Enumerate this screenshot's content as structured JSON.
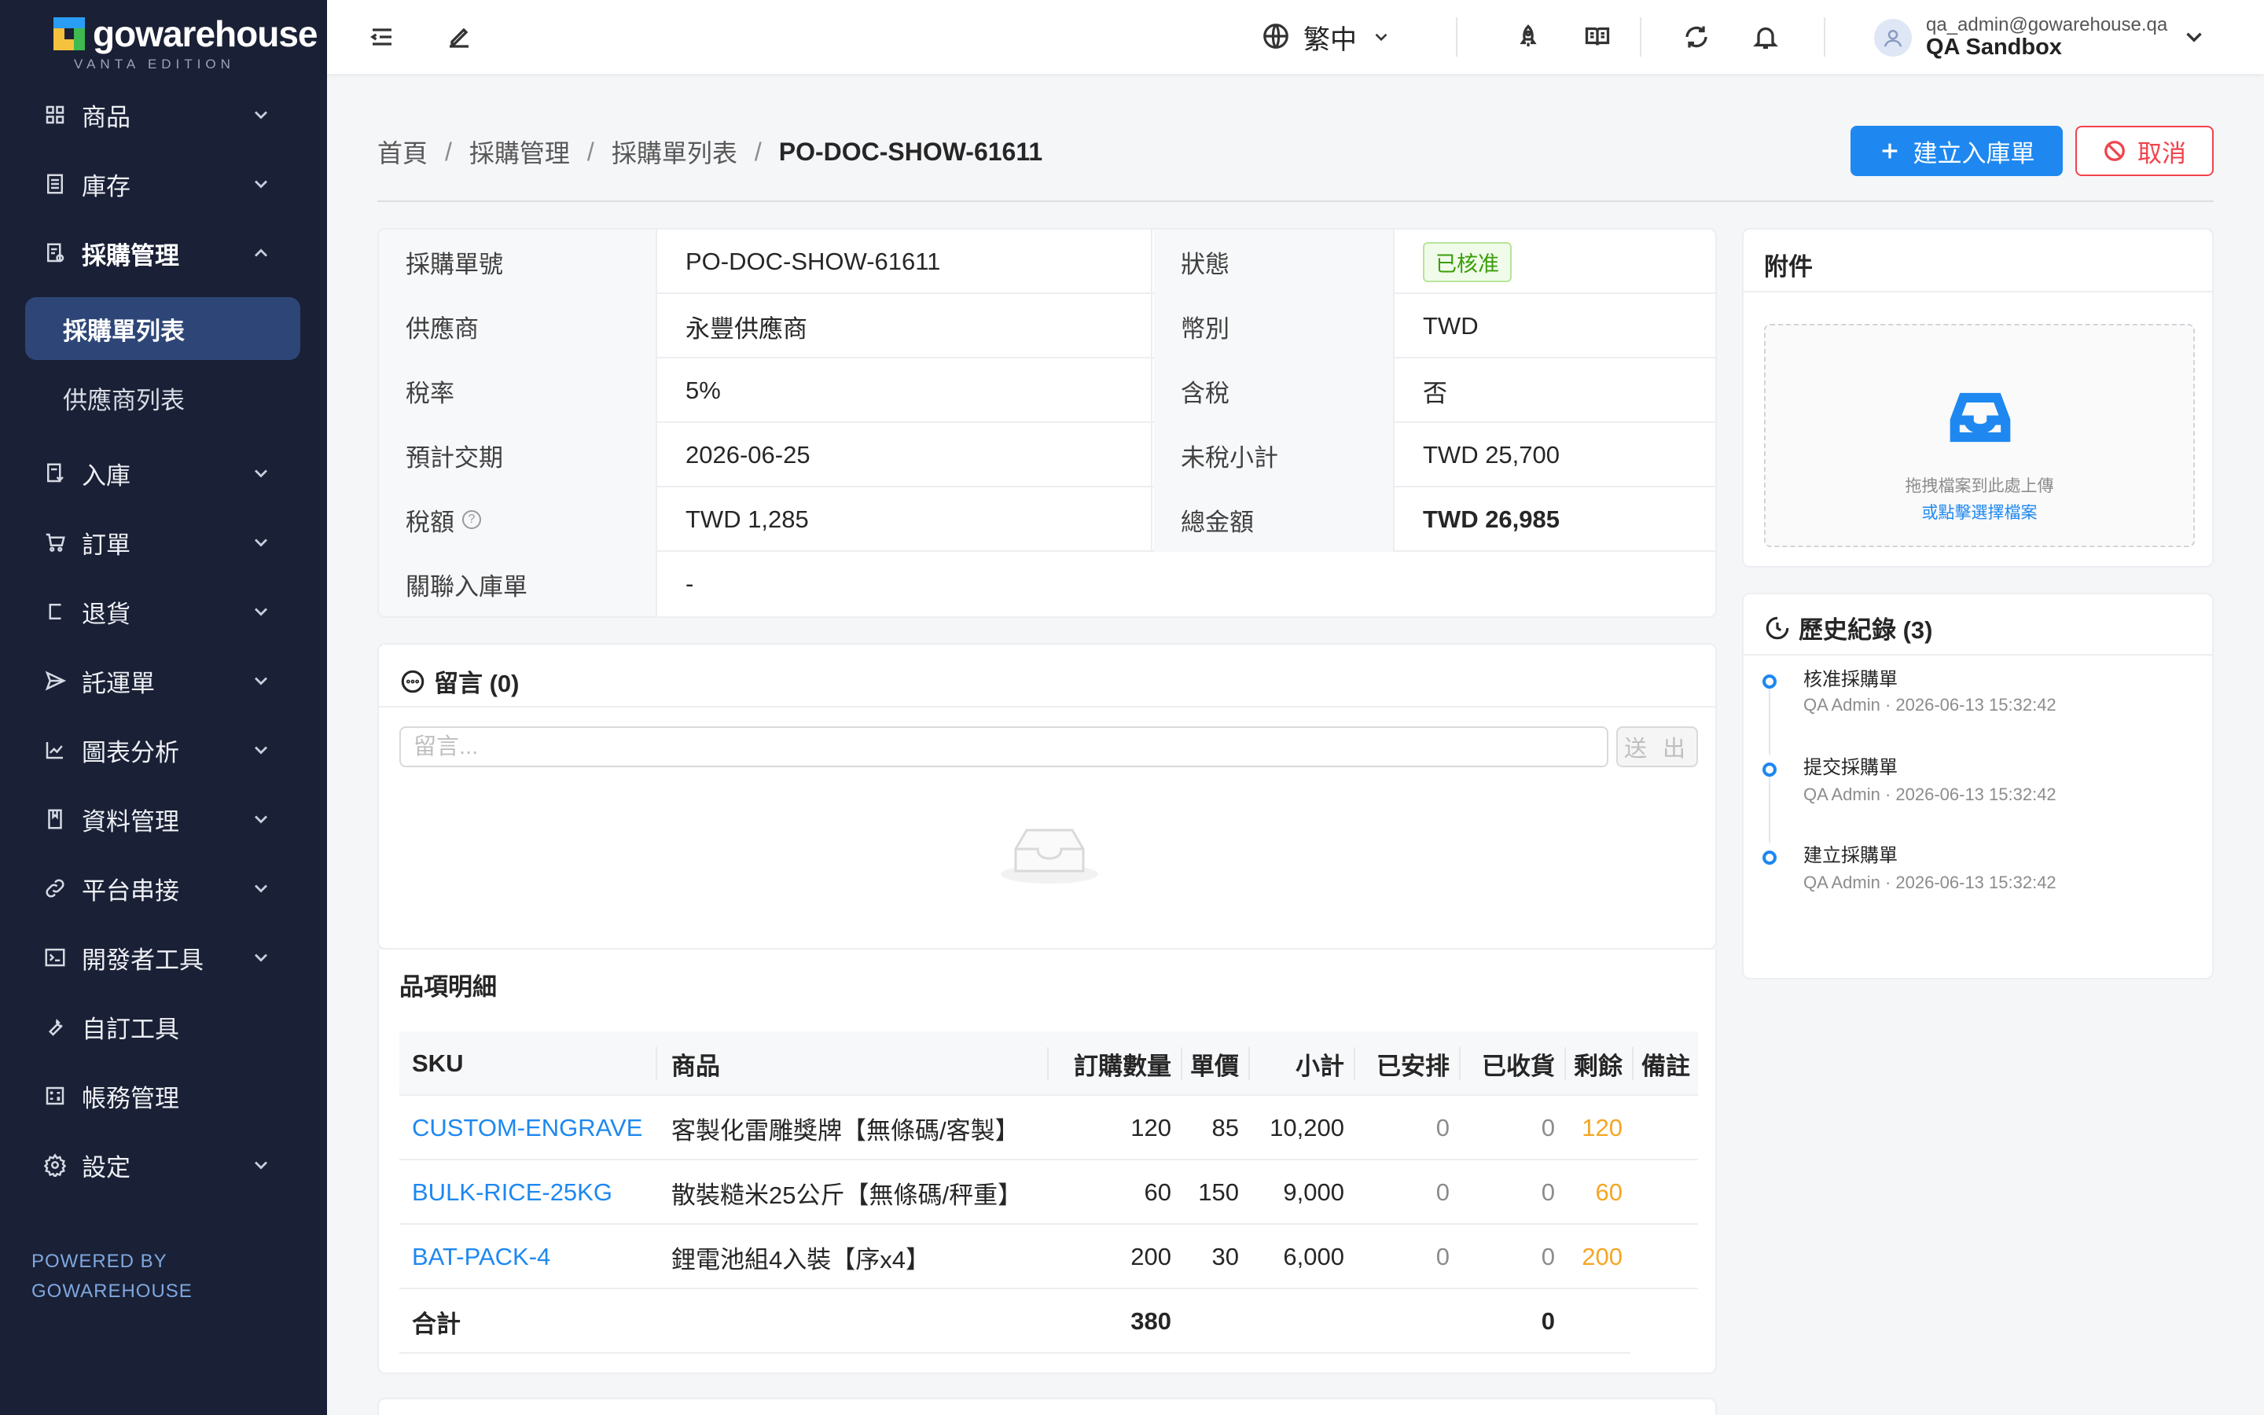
{
  "brand": {
    "name": "gowarehouse",
    "edition": "VANTA EDITION"
  },
  "sidebar": {
    "items": [
      {
        "label": "商品",
        "icon": "grid-icon",
        "expandable": true
      },
      {
        "label": "庫存",
        "icon": "inventory-icon",
        "expandable": true
      },
      {
        "label": "採購管理",
        "icon": "purchase-icon",
        "expandable": true,
        "open": true,
        "children": [
          {
            "label": "採購單列表",
            "active": true
          },
          {
            "label": "供應商列表"
          }
        ]
      },
      {
        "label": "入庫",
        "icon": "inbound-icon",
        "expandable": true
      },
      {
        "label": "訂單",
        "icon": "cart-icon",
        "expandable": true
      },
      {
        "label": "退貨",
        "icon": "return-icon",
        "expandable": true
      },
      {
        "label": "託運單",
        "icon": "send-icon",
        "expandable": true
      },
      {
        "label": "圖表分析",
        "icon": "chart-icon",
        "expandable": true
      },
      {
        "label": "資料管理",
        "icon": "book-icon",
        "expandable": true
      },
      {
        "label": "平台串接",
        "icon": "link-icon",
        "expandable": true
      },
      {
        "label": "開發者工具",
        "icon": "terminal-icon",
        "expandable": true
      },
      {
        "label": "自訂工具",
        "icon": "wrench-icon",
        "expandable": false
      },
      {
        "label": "帳務管理",
        "icon": "calculator-icon",
        "expandable": false
      },
      {
        "label": "設定",
        "icon": "gear-icon",
        "expandable": true
      }
    ],
    "powered_by": [
      "POWERED BY",
      "GOWAREHOUSE"
    ]
  },
  "header": {
    "language": "繁中",
    "user": {
      "email": "qa_admin@gowarehouse.qa",
      "org": "QA Sandbox"
    }
  },
  "breadcrumb": [
    "首頁",
    "採購管理",
    "採購單列表",
    "PO-DOC-SHOW-61611"
  ],
  "actions": {
    "create_inbound": "建立入庫單",
    "cancel": "取消"
  },
  "info": {
    "rows": [
      {
        "k1": "採購單號",
        "v1": "PO-DOC-SHOW-61611",
        "k2": "狀態",
        "v2": "已核准"
      },
      {
        "k1": "供應商",
        "v1": "永豐供應商",
        "k2": "幣別",
        "v2": "TWD"
      },
      {
        "k1": "稅率",
        "v1": "5%",
        "k2": "含稅",
        "v2": "否"
      },
      {
        "k1": "預計交期",
        "v1": "2026-06-25",
        "k2": "未稅小計",
        "v2": "TWD 25,700"
      },
      {
        "k1": "稅額",
        "v1": "TWD 1,285",
        "k2": "總金額",
        "v2": "TWD 26,985"
      },
      {
        "k1": "關聯入庫單",
        "v1": "-"
      }
    ]
  },
  "comments": {
    "title": "留言 (0)",
    "placeholder": "留言...",
    "send": "送 出"
  },
  "items": {
    "title": "品項明細",
    "columns": [
      "SKU",
      "商品",
      "訂購數量",
      "單價",
      "小計",
      "已安排",
      "已收貨",
      "剩餘",
      "備註"
    ],
    "rows": [
      {
        "sku": "CUSTOM-ENGRAVE",
        "product": "客製化雷雕獎牌【無條碼/客製】",
        "qty": "120",
        "price": "85",
        "subtotal": "10,200",
        "scheduled": "0",
        "received": "0",
        "remaining": "120",
        "note": ""
      },
      {
        "sku": "BULK-RICE-25KG",
        "product": "散裝糙米25公斤【無條碼/秤重】",
        "qty": "60",
        "price": "150",
        "subtotal": "9,000",
        "scheduled": "0",
        "received": "0",
        "remaining": "60",
        "note": ""
      },
      {
        "sku": "BAT-PACK-4",
        "product": "鋰電池組4入裝【序x4】",
        "qty": "200",
        "price": "30",
        "subtotal": "6,000",
        "scheduled": "0",
        "received": "0",
        "remaining": "200",
        "note": ""
      }
    ],
    "total": {
      "label": "合計",
      "qty": "380",
      "received": "0"
    }
  },
  "attachments": {
    "title": "附件",
    "hint": "拖拽檔案到此處上傳",
    "link": "或點擊選擇檔案"
  },
  "history": {
    "title": "歷史紀錄 (3)",
    "events": [
      {
        "title": "核准採購單",
        "meta": "QA Admin · 2026-06-13 15:32:42"
      },
      {
        "title": "提交採購單",
        "meta": "QA Admin · 2026-06-13 15:32:42"
      },
      {
        "title": "建立採購單",
        "meta": "QA Admin · 2026-06-13 15:32:42"
      }
    ]
  },
  "colors": {
    "sidebar_bg": "#1a2035",
    "primary": "#1e88f0",
    "danger": "#f0434c",
    "success": "#3a9d0a",
    "warning": "#f5a623"
  }
}
